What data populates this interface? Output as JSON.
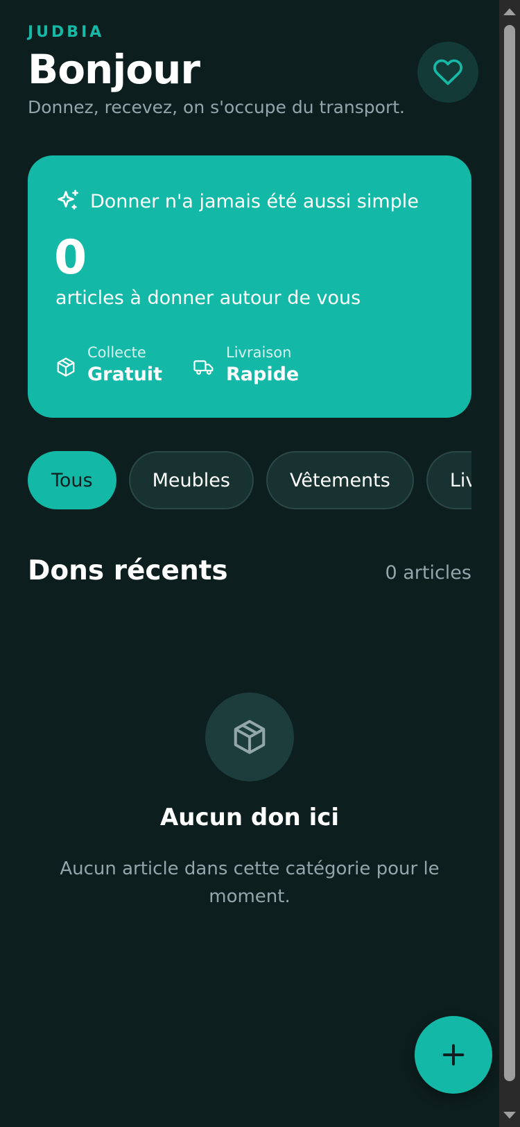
{
  "header": {
    "brand": "JUDBIA",
    "title": "Bonjour",
    "subtitle": "Donnez, recevez, on s'occupe du transport."
  },
  "hero": {
    "tagline": "Donner n'a jamais été aussi simple",
    "count": "0",
    "description": "articles à donner autour de vous",
    "stats": [
      {
        "label": "Collecte",
        "value": "Gratuit",
        "icon": "box-icon"
      },
      {
        "label": "Livraison",
        "value": "Rapide",
        "icon": "truck-icon"
      }
    ]
  },
  "categories": [
    "Tous",
    "Meubles",
    "Vêtements",
    "Livr"
  ],
  "section": {
    "title": "Dons récents",
    "count": "0 articles"
  },
  "empty": {
    "title": "Aucun don ici",
    "description": "Aucun article dans cette catégorie pour le moment."
  },
  "colors": {
    "background": "#0d1e1e",
    "accent": "#14b8a6",
    "muted_text": "#93a6ab"
  }
}
